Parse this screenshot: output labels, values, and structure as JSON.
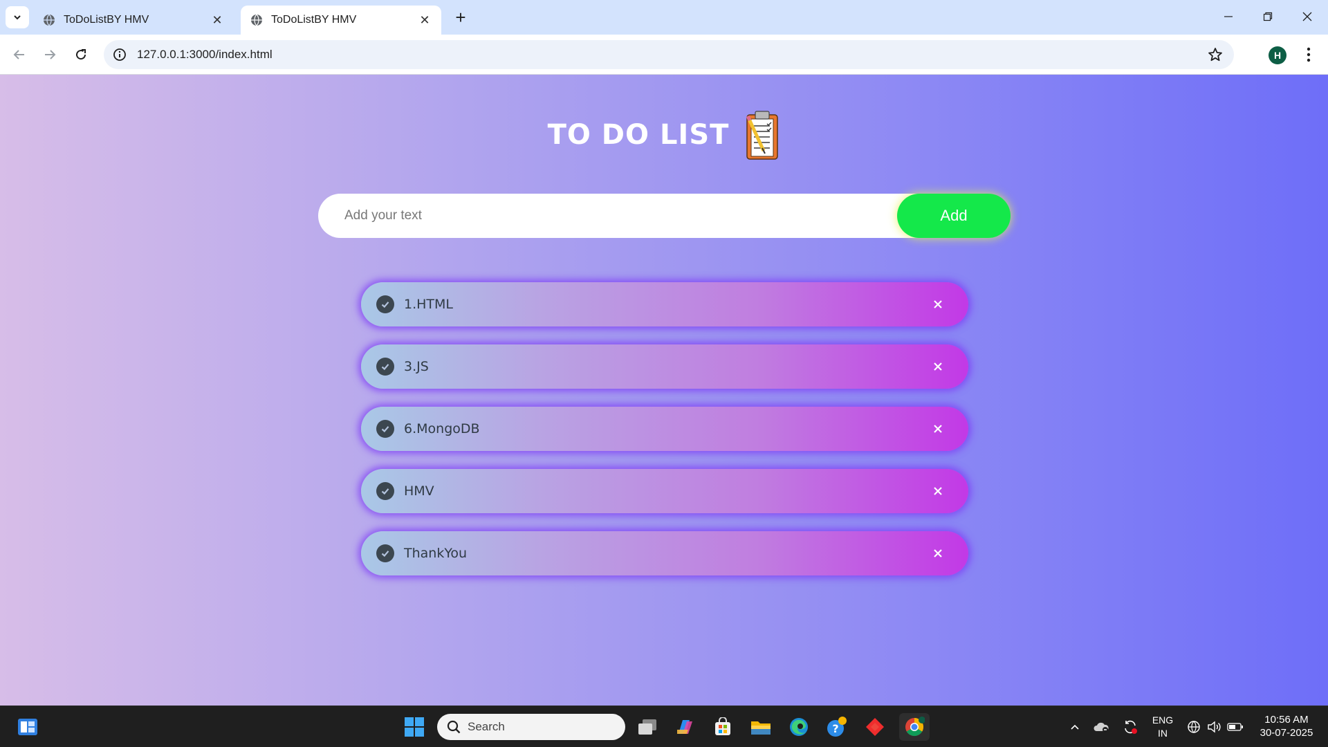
{
  "browser": {
    "tabs": [
      {
        "title": "ToDoListBY HMV",
        "active": false
      },
      {
        "title": "ToDoListBY HMV",
        "active": true
      }
    ],
    "address": "127.0.0.1:3000/index.html",
    "profile_initial": "H"
  },
  "app": {
    "title": "TO DO LIST",
    "input_placeholder": "Add your text",
    "add_label": "Add",
    "tasks": [
      {
        "label": "1.HTML",
        "checked": true
      },
      {
        "label": "3.JS",
        "checked": true
      },
      {
        "label": "6.MongoDB",
        "checked": true
      },
      {
        "label": "HMV",
        "checked": true
      },
      {
        "label": "ThankYou",
        "checked": true
      }
    ],
    "colors": {
      "add_button": "#14e84a",
      "heading": "#ffffff",
      "task_glow": "#7d3cf5"
    }
  },
  "taskbar": {
    "search_label": "Search",
    "language": "ENG",
    "region": "IN",
    "time": "10:56 AM",
    "date": "30-07-2025"
  }
}
